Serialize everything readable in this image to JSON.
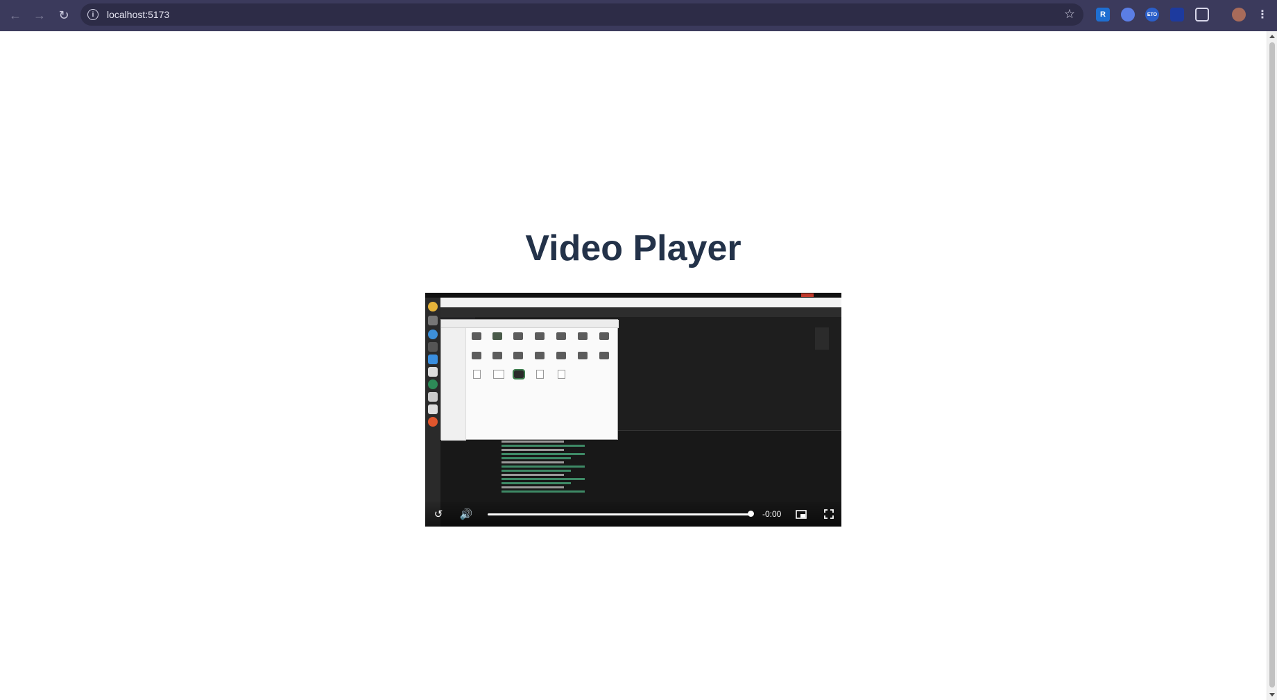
{
  "browser": {
    "url": "localhost:5173",
    "back_icon": "arrow-left-icon",
    "forward_icon": "arrow-right-icon",
    "reload_icon": "reload-icon",
    "bookmark_icon": "star-icon",
    "extensions": [
      "R",
      "",
      "ETO",
      "",
      "",
      ""
    ],
    "colors": {
      "toolbar": "#3b3a5c",
      "omnibox": "#2d2c47"
    }
  },
  "page": {
    "title": "Video Player",
    "title_color": "#233249"
  },
  "video": {
    "time_remaining": "-0:00",
    "progress": 1.0,
    "controls": {
      "replay_icon": "replay-icon",
      "volume_icon": "volume-icon",
      "pip_icon": "picture-in-picture-icon",
      "fullscreen_icon": "fullscreen-icon"
    }
  }
}
